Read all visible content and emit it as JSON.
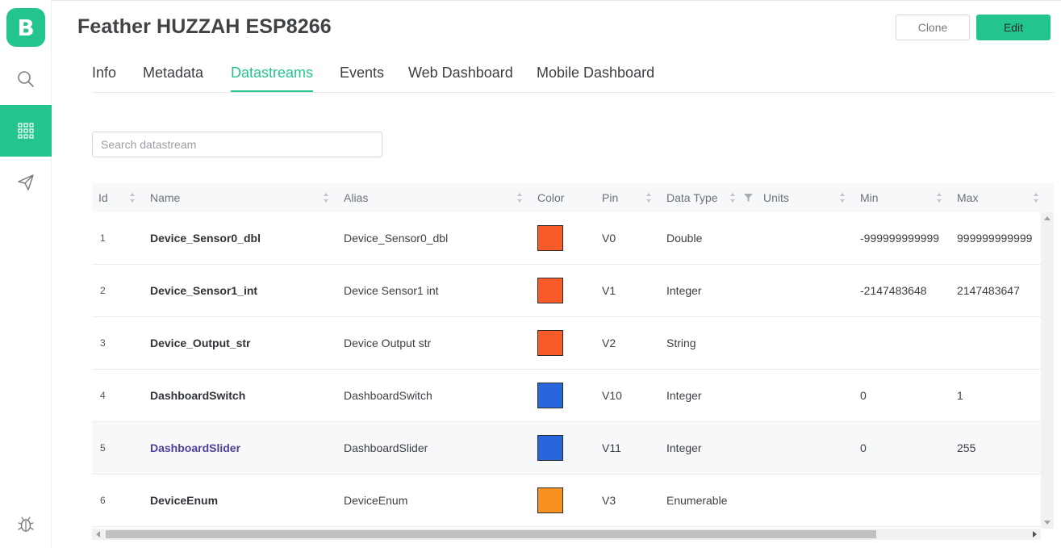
{
  "sidebar": {
    "logo_letter": "B",
    "items": [
      {
        "icon": "search-icon"
      },
      {
        "icon": "grid-icon",
        "active": true
      },
      {
        "icon": "send-icon"
      },
      {
        "icon": "bug-icon"
      }
    ]
  },
  "header": {
    "title": "Feather HUZZAH ESP8266",
    "clone_label": "Clone",
    "edit_label": "Edit"
  },
  "tabs": [
    {
      "label": "Info"
    },
    {
      "label": "Metadata"
    },
    {
      "label": "Datastreams",
      "active": true
    },
    {
      "label": "Events"
    },
    {
      "label": "Web Dashboard"
    },
    {
      "label": "Mobile Dashboard"
    }
  ],
  "search": {
    "placeholder": "Search datastream",
    "value": ""
  },
  "table": {
    "columns": [
      "Id",
      "Name",
      "Alias",
      "Color",
      "Pin",
      "Data Type",
      "Units",
      "Min",
      "Max"
    ],
    "rows": [
      {
        "id": "1",
        "name": "Device_Sensor0_dbl",
        "alias": "Device_Sensor0_dbl",
        "color": "#fa5a28",
        "pin": "V0",
        "data_type": "Double",
        "units": "",
        "min": "-999999999999",
        "max": "999999999999"
      },
      {
        "id": "2",
        "name": "Device_Sensor1_int",
        "alias": "Device Sensor1 int",
        "color": "#fa5a28",
        "pin": "V1",
        "data_type": "Integer",
        "units": "",
        "min": "-2147483648",
        "max": "2147483647"
      },
      {
        "id": "3",
        "name": "Device_Output_str",
        "alias": "Device Output str",
        "color": "#fa5a28",
        "pin": "V2",
        "data_type": "String",
        "units": "",
        "min": "",
        "max": ""
      },
      {
        "id": "4",
        "name": "DashboardSwitch",
        "alias": "DashboardSwitch",
        "color": "#2766dd",
        "pin": "V10",
        "data_type": "Integer",
        "units": "",
        "min": "0",
        "max": "1"
      },
      {
        "id": "5",
        "name": "DashboardSlider",
        "alias": "DashboardSlider",
        "color": "#2766dd",
        "pin": "V11",
        "data_type": "Integer",
        "units": "",
        "min": "0",
        "max": "255"
      },
      {
        "id": "6",
        "name": "DeviceEnum",
        "alias": "DeviceEnum",
        "color": "#f7911f",
        "pin": "V3",
        "data_type": "Enumerable",
        "units": "",
        "min": "",
        "max": ""
      }
    ]
  },
  "colors": {
    "accent": "#23c48e",
    "link": "#4b3f9c"
  }
}
